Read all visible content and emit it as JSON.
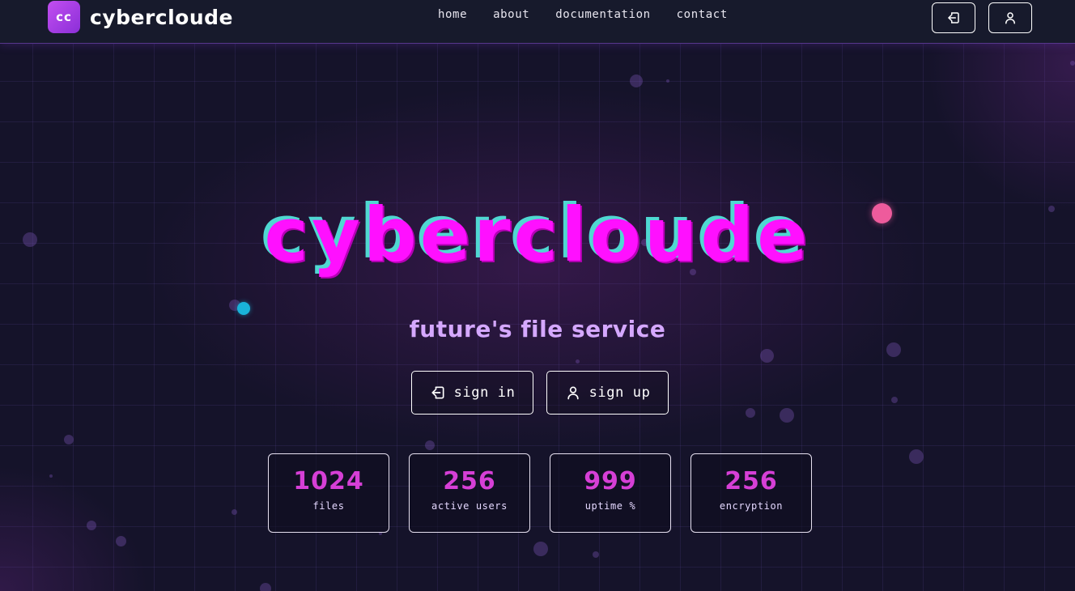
{
  "brand": {
    "badge": "cc",
    "name": "cybercloude"
  },
  "nav": {
    "items": [
      "home",
      "about",
      "documentation",
      "contact"
    ]
  },
  "header_actions": {
    "login_icon": "login-icon",
    "user_icon": "user-icon"
  },
  "hero": {
    "title": "cybercloude",
    "subtitle": "future's file service",
    "signin_label": "sign in",
    "signup_label": "sign up"
  },
  "stats": [
    {
      "value": "1024",
      "label": "files"
    },
    {
      "value": "256",
      "label": "active users"
    },
    {
      "value": "999",
      "label": "uptime %"
    },
    {
      "value": "256",
      "label": "encryption"
    }
  ],
  "colors": {
    "background": "#15132a",
    "accent_magenta": "#ff10ff",
    "accent_cyan": "#4fd8d2",
    "subtitle": "#d5a8ff",
    "stat_value": "#d63fd6",
    "orb_pink": "#ee5b9c",
    "orb_cyan": "#19b3d9"
  }
}
